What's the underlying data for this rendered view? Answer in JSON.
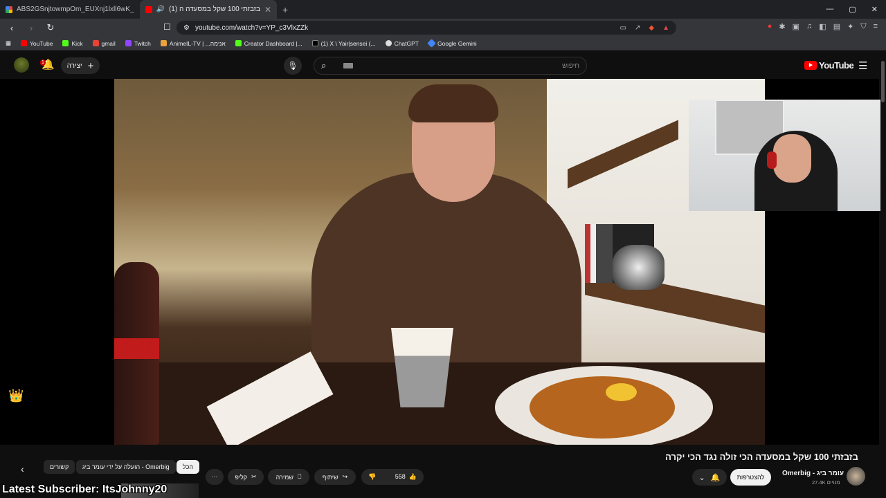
{
  "browser": {
    "tabs": [
      {
        "title": "ABS2GSnjtowmpOm_EUXnj1lxll6wK_",
        "active": false
      },
      {
        "title": "(1) בזבזתי 100 שקל במסעדה ה",
        "active": true
      }
    ],
    "new_tab": "+",
    "window_controls": [
      "—",
      "▢",
      "✕"
    ],
    "url": "youtube.com/watch?v=YP_c3VlxZZk",
    "bookmarks": [
      {
        "label": "YouTube",
        "color": "#ff0000"
      },
      {
        "label": "Kick",
        "color": "#53fc18"
      },
      {
        "label": "gmail",
        "color": "#ea4335"
      },
      {
        "label": "Twitch",
        "color": "#9146ff"
      },
      {
        "label": "AnimeIL-TV | ...אנימה",
        "color": "#e8a33d"
      },
      {
        "label": "Creator Dashboard |...",
        "color": "#53fc18"
      },
      {
        "label": "(1) X \\ Yair|sensei (...",
        "color": "#000000"
      },
      {
        "label": "ChatGPT",
        "color": "#dddddd"
      },
      {
        "label": "Google Gemini",
        "color": "#4285f4"
      }
    ]
  },
  "yt": {
    "notifications_badge": "1",
    "create_label": "יצירה",
    "search_placeholder": "חיפוש",
    "logo_text": "YouTube"
  },
  "video": {
    "title": "בזבזתי 100 שקל במסעדה הכי זולה נגד הכי יקרה",
    "channel_name": "Omerbig - עומר ביג",
    "subscribers": "27.4K מנויים",
    "subscribe_label": "להצטרפות",
    "likes": "558",
    "share_label": "שיתוף",
    "save_label": "שמירה",
    "clip_label": "קליפ",
    "more_label": "⋯"
  },
  "chips": {
    "all": "הכל",
    "uploaded_by": "Omerbig - הועלה על ידי עומר ביג",
    "related": "קשורים"
  },
  "overlay": {
    "latest_subscriber": "Latest Subscriber: ItsJohnny20"
  },
  "colors": {
    "accent": "#ff0000",
    "background": "#0f0f0f"
  }
}
